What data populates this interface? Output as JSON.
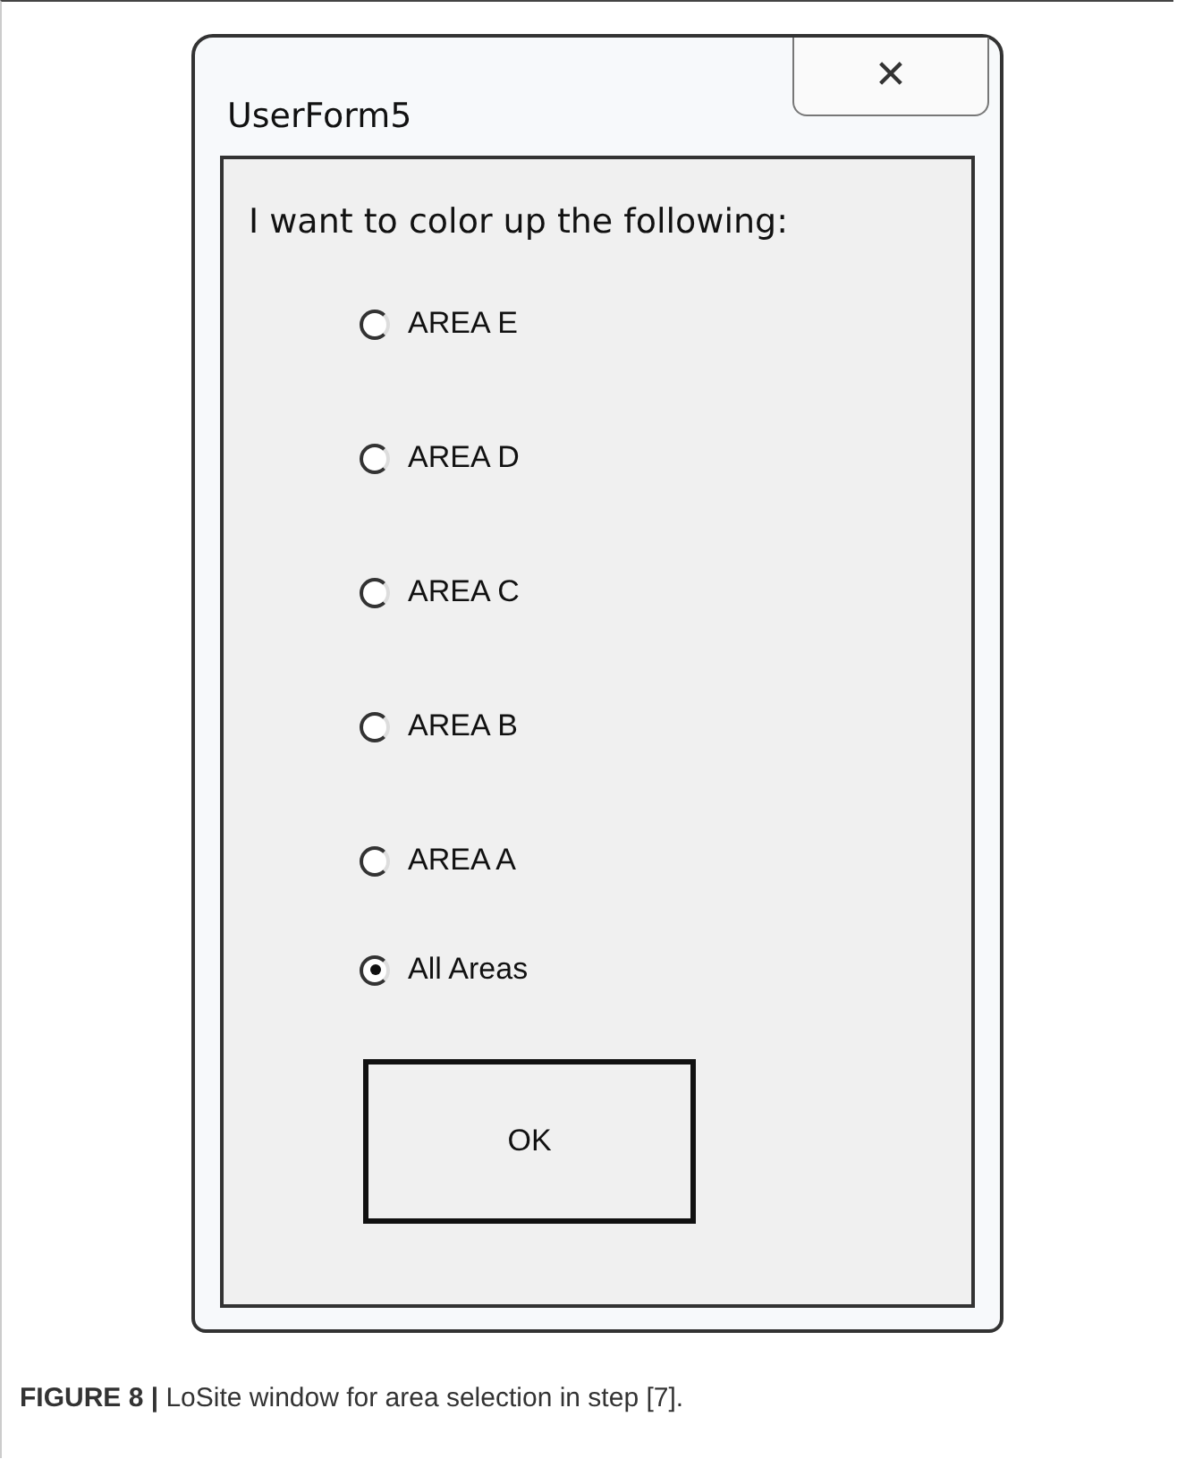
{
  "window": {
    "title": "UserForm5",
    "close": "✕"
  },
  "prompt": "I want to color up the following:",
  "options": [
    {
      "label": "AREA E",
      "selected": false
    },
    {
      "label": "AREA D",
      "selected": false
    },
    {
      "label": "AREA C",
      "selected": false
    },
    {
      "label": "AREA B",
      "selected": false
    },
    {
      "label": "AREA A",
      "selected": false
    },
    {
      "label": "All Areas",
      "selected": true
    }
  ],
  "buttons": [
    "OK"
  ],
  "caption": "**FIGURE 8 |** LoSite window for area selection in step [7]."
}
